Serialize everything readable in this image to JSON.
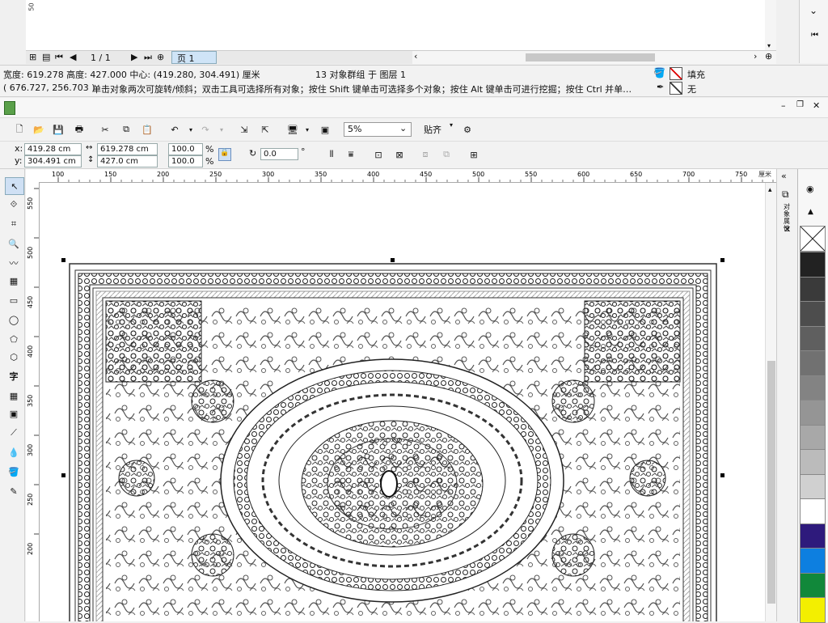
{
  "prev_window": {
    "ruler_mark": "50",
    "page_counter": "1 / 1",
    "page_tab": "页 1"
  },
  "status": {
    "line1_dims": "宽度: 619.278  高度: 427.000  中心: (419.280, 304.491)  厘米",
    "line1_selection": "13 对象群组 于 图层 1",
    "line2_coords": "( 676.727, 256.703 )",
    "line2_hint": "单击对象两次可旋转/倾斜；双击工具可选择所有对象；按住 Shift 键单击可选择多个对象；按住 Alt 键单击可进行挖掘；按住 Ctrl 并单…",
    "fill_label": "填充",
    "outline_label": "无"
  },
  "toolbar": {
    "zoom_value": "5%",
    "snap_label": "贴齐"
  },
  "propbar": {
    "x_label": "x:",
    "x_value": "419.28 cm",
    "y_label": "y:",
    "y_value": "304.491 cm",
    "width_value": "619.278 cm",
    "height_value": "427.0 cm",
    "scale_w": "100.0",
    "scale_h": "100.0",
    "pct": "%",
    "rotation": "0.0",
    "degree": "°"
  },
  "hruler_ticks": [
    "100",
    "150",
    "200",
    "250",
    "300",
    "350",
    "400",
    "450",
    "500",
    "550",
    "600",
    "650",
    "700",
    "750"
  ],
  "hruler_unit": "厘米",
  "vruler_ticks": [
    "550",
    "500",
    "450",
    "400",
    "350",
    "300",
    "250",
    "200"
  ],
  "docker_label": "对象属性",
  "palette": [
    "#222222",
    "#3a3a3a",
    "#4d4d4d",
    "#5f5f5f",
    "#717171",
    "#838383",
    "#959595",
    "#a8a8a8",
    "#bbbbbb",
    "#d0d0d0",
    "#ffffff",
    "#2e1a7c",
    "#0d7fe0",
    "#11883a",
    "#f3ef00"
  ]
}
